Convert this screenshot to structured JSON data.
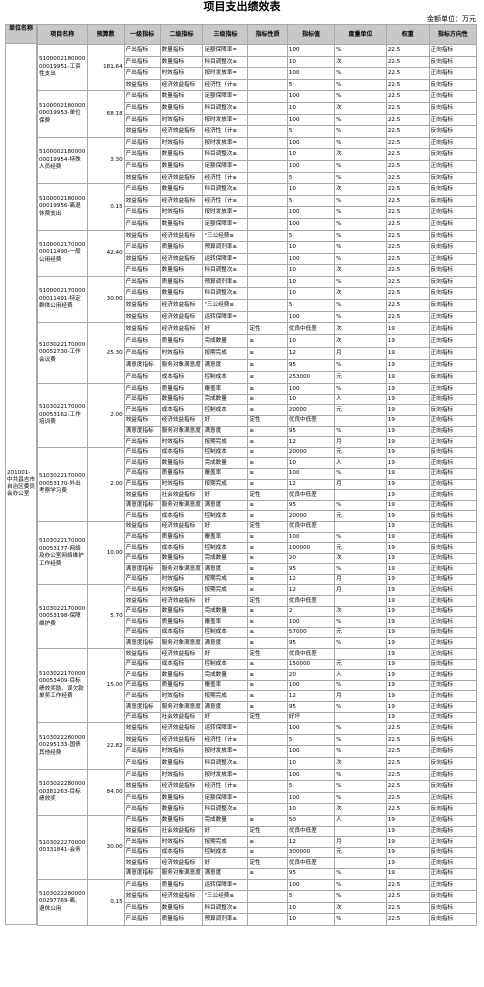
{
  "doc": {
    "title": "项目支出绩效表",
    "unit": "金额单位：万元"
  },
  "headers": [
    "单位名称",
    "项目名称",
    "预算数",
    "一级指标",
    "二级指标",
    "三级指标",
    "指标性质",
    "指标值",
    "度量单位",
    "权重",
    "指标方向性"
  ],
  "unit_name": "201001-中共昌吉市自治区委员会办公室",
  "projects": [
    {
      "name": "510000218000000019951-工资性支出",
      "amount": "181.64",
      "rows": [
        [
          "产出指标",
          "数量指标",
          "足额保障率=",
          "100",
          "%",
          "22.5",
          "正向指标"
        ],
        [
          "产出指标",
          "数量指标",
          "科目调整次≤",
          "10",
          "次",
          "22.5",
          "反向指标"
        ],
        [
          "产出指标",
          "时效指标",
          "按时发放率=",
          "100",
          "%",
          "22.5",
          "正向指标"
        ],
        [
          "效益指标",
          "经济效益指标",
          "经济性（计≤",
          "5",
          "%",
          "22.5",
          "反向指标"
        ]
      ]
    },
    {
      "name": "510000218000000019953-单位保费",
      "amount": "68.18",
      "rows": [
        [
          "产出指标",
          "数量指标",
          "足额保障率=",
          "100",
          "%",
          "22.5",
          "正向指标"
        ],
        [
          "产出指标",
          "数量指标",
          "科目调整次≤",
          "10",
          "次",
          "22.5",
          "反向指标"
        ],
        [
          "产出指标",
          "时效指标",
          "按时发放率=",
          "100",
          "%",
          "22.5",
          "正向指标"
        ],
        [
          "效益指标",
          "经济效益指标",
          "经济性（计≤",
          "5",
          "%",
          "22.5",
          "反向指标"
        ]
      ]
    },
    {
      "name": "510000218000000019954-特殊人员经费",
      "amount": "3.30",
      "rows": [
        [
          "产出指标",
          "时效指标",
          "按时发放率=",
          "100",
          "%",
          "22.5",
          "正向指标"
        ],
        [
          "产出指标",
          "数量指标",
          "科目调整次≤",
          "10",
          "次",
          "22.5",
          "反向指标"
        ],
        [
          "产出指标",
          "数量指标",
          "足额保障率=",
          "100",
          "%",
          "22.5",
          "正向指标"
        ],
        [
          "效益指标",
          "经济效益指标",
          "经济性（计≤",
          "5",
          "%",
          "22.5",
          "反向指标"
        ]
      ]
    },
    {
      "name": "510000218000000019956-离退休费支出",
      "amount": "0.15",
      "rows": [
        [
          "产出指标",
          "数量指标",
          "科目调整次≤",
          "10",
          "次",
          "22.5",
          "反向指标"
        ],
        [
          "效益指标",
          "经济效益指标",
          "经济性（计≤",
          "5",
          "%",
          "22.5",
          "反向指标"
        ],
        [
          "产出指标",
          "时效指标",
          "按时发放率=",
          "100",
          "%",
          "22.5",
          "正向指标"
        ],
        [
          "产出指标",
          "数量指标",
          "足额保障率=",
          "100",
          "%",
          "22.5",
          "正向指标"
        ]
      ]
    },
    {
      "name": "510000217000000011490-一般公用经费",
      "amount": "42.40",
      "rows": [
        [
          "效益指标",
          "经济效益指标",
          "\"三公经费≤",
          "5",
          "%",
          "22.5",
          "反向指标"
        ],
        [
          "产出指标",
          "质量指标",
          "预算调剂率≤",
          "10",
          "%",
          "22.5",
          "反向指标"
        ],
        [
          "效益指标",
          "经济效益指标",
          "运转保障率=",
          "100",
          "%",
          "22.5",
          "正向指标"
        ],
        [
          "产出指标",
          "数量指标",
          "科目调整次≤",
          "10",
          "次",
          "22.5",
          "反向指标"
        ]
      ]
    },
    {
      "name": "510000217000000011491-特定群体公用经费",
      "amount": "30.00",
      "rows": [
        [
          "产出指标",
          "质量指标",
          "预算调剂率≤",
          "10",
          "%",
          "22.5",
          "反向指标"
        ],
        [
          "产出指标",
          "数量指标",
          "科目调整次≤",
          "10",
          "次",
          "22.5",
          "反向指标"
        ],
        [
          "效益指标",
          "经济效益指标",
          "\"三公经费≤",
          "5",
          "%",
          "22.5",
          "反向指标"
        ],
        [
          "效益指标",
          "经济效益指标",
          "运转保障率=",
          "100",
          "%",
          "22.5",
          "正向指标"
        ]
      ]
    },
    {
      "name": "510302217000000052730-工作会议费",
      "amount": "25.30",
      "rows": [
        [
          "效益指标",
          "经济效益指标",
          "好",
          "定性",
          "优良中低差",
          "次",
          "19",
          "正向指标"
        ],
        [
          "产出指标",
          "质量指标",
          "完成数量",
          "≥",
          "10",
          "次",
          "19",
          "正向指标"
        ],
        [
          "产出指标",
          "时效指标",
          "按期完成",
          "≥",
          "12",
          "月",
          "19",
          "正向指标"
        ],
        [
          "满意度指标",
          "服务对象满意度",
          "满意度",
          "≥",
          "95",
          "%",
          "19",
          "正向指标"
        ],
        [
          "产出指标",
          "成本指标",
          "控制成本",
          "≤",
          "253000",
          "元",
          "19",
          "反向指标"
        ]
      ]
    },
    {
      "name": "510302217000000053162-工作培训费",
      "amount": "2.00",
      "rows": [
        [
          "产出指标",
          "质量指标",
          "覆盖率",
          "≥",
          "100",
          "%",
          "19",
          "正向指标"
        ],
        [
          "产出指标",
          "数量指标",
          "完成数量",
          "≥",
          "10",
          "人",
          "19",
          "正向指标"
        ],
        [
          "产出指标",
          "成本指标",
          "控制成本",
          "≤",
          "20000",
          "元",
          "19",
          "反向指标"
        ],
        [
          "效益指标",
          "经济效益指标",
          "好",
          "定性",
          "优良中低差",
          "",
          "19",
          "正向指标"
        ],
        [
          "满意度指标",
          "服务对象满意度",
          "满意度",
          "≥",
          "95",
          "%",
          "19",
          "正向指标"
        ],
        [
          "产出指标",
          "时效指标",
          "按期完成",
          "≤",
          "12",
          "月",
          "19",
          "正向指标"
        ]
      ]
    },
    {
      "name": "510302217000000053170-外出考察学习费",
      "amount": "2.00",
      "rows": [
        [
          "产出指标",
          "成本指标",
          "控制成本",
          "≤",
          "20000",
          "元",
          "19",
          "反向指标"
        ],
        [
          "产出指标",
          "数量指标",
          "完成数量",
          "≥",
          "10",
          "人",
          "19",
          "正向指标"
        ],
        [
          "产出指标",
          "质量指标",
          "覆盖率",
          "≥",
          "100",
          "%",
          "19",
          "正向指标"
        ],
        [
          "产出指标",
          "时效指标",
          "按期完成",
          "≤",
          "12",
          "月",
          "19",
          "正向指标"
        ],
        [
          "效益指标",
          "社会效益指标",
          "好",
          "定性",
          "优良中低差",
          "",
          "19",
          "正向指标"
        ],
        [
          "满意度指标",
          "服务对象满意度",
          "满意度",
          "≥",
          "95",
          "%",
          "19",
          "正向指标"
        ],
        [
          "产出指标",
          "成本指标",
          "控制成本",
          "≤",
          "20000",
          "元",
          "19",
          "反向指标"
        ]
      ]
    },
    {
      "name": "510302217000000053177-网络及办公室网络维护工作经费",
      "amount": "10.00",
      "rows": [
        [
          "效益指标",
          "经济效益指标",
          "好",
          "定性",
          "优良中低差",
          "",
          "19",
          "正向指标"
        ],
        [
          "产出指标",
          "质量指标",
          "覆盖率",
          "≥",
          "100",
          "%",
          "19",
          "正向指标"
        ],
        [
          "产出指标",
          "成本指标",
          "控制成本",
          "≤",
          "100000",
          "元",
          "19",
          "反向指标"
        ],
        [
          "产出指标",
          "数量指标",
          "完成数量",
          "≥",
          "20",
          "次",
          "19",
          "正向指标"
        ],
        [
          "满意度指标",
          "服务对象满意度",
          "满意度",
          "≥",
          "95",
          "%",
          "19",
          "正向指标"
        ],
        [
          "产出指标",
          "时效指标",
          "按期完成",
          "≤",
          "12",
          "月",
          "19",
          "正向指标"
        ]
      ]
    },
    {
      "name": "510302217000000053198-保障维护费",
      "amount": "5.70",
      "rows": [
        [
          "产出指标",
          "时效指标",
          "按期完成",
          "≤",
          "12",
          "月",
          "19",
          "正向指标"
        ],
        [
          "效益指标",
          "经济效益指标",
          "好",
          "定性",
          "优良中低差",
          "",
          "19",
          "正向指标"
        ],
        [
          "产出指标",
          "数量指标",
          "完成数量",
          "≥",
          "2",
          "次",
          "19",
          "正向指标"
        ],
        [
          "产出指标",
          "质量指标",
          "覆盖率",
          "≥",
          "100",
          "%",
          "19",
          "正向指标"
        ],
        [
          "产出指标",
          "成本指标",
          "控制成本",
          "≤",
          "57000",
          "元",
          "19",
          "反向指标"
        ],
        [
          "满意度指标",
          "服务对象满意度",
          "满意度",
          "≥",
          "95",
          "%",
          "19",
          "正向指标"
        ]
      ]
    },
    {
      "name": "510302217000000053409-目标绩效奖励、误欠款单奖工作经费",
      "amount": "15.00",
      "rows": [
        [
          "效益指标",
          "经济效益指标",
          "好",
          "定性",
          "优良中低差",
          "",
          "19",
          "正向指标"
        ],
        [
          "产出指标",
          "成本指标",
          "控制成本",
          "≤",
          "150000",
          "元",
          "19",
          "反向指标"
        ],
        [
          "产出指标",
          "数量指标",
          "完成数量",
          "≥",
          "20",
          "人",
          "19",
          "正向指标"
        ],
        [
          "产出指标",
          "质量指标",
          "覆盖率",
          "≥",
          "100",
          "%",
          "19",
          "正向指标"
        ],
        [
          "产出指标",
          "时效指标",
          "按期完成",
          "≤",
          "12",
          "月",
          "19",
          "正向指标"
        ],
        [
          "满意度指标",
          "服务对象满意度",
          "满意度",
          "≥",
          "95",
          "%",
          "19",
          "正向指标"
        ],
        [
          "产出指标",
          "社会效益指标",
          "好",
          "定性",
          "好坏",
          "",
          "19",
          "正向指标"
        ]
      ]
    },
    {
      "name": "510302228000000295133-国债其他经费",
      "amount": "22.82",
      "rows": [
        [
          "效益指标",
          "经济效益指标",
          "运转保障率=",
          "100",
          "%",
          "22.5",
          "正向指标"
        ],
        [
          "效益指标",
          "经济效益指标",
          "经济性（计≤",
          "5",
          "%",
          "22.5",
          "反向指标"
        ],
        [
          "产出指标",
          "时效指标",
          "按时发放率=",
          "100",
          "%",
          "22.5",
          "正向指标"
        ],
        [
          "产出指标",
          "数量指标",
          "科目调整次≤",
          "10",
          "次",
          "22.5",
          "反向指标"
        ]
      ]
    },
    {
      "name": "510302228000000381263-目标绩效奖",
      "amount": "84.00",
      "rows": [
        [
          "产出指标",
          "时效指标",
          "按时发放率=",
          "100",
          "%",
          "22.5",
          "正向指标"
        ],
        [
          "效益指标",
          "经济效益指标",
          "经济性（计≤",
          "5",
          "%",
          "22.5",
          "反向指标"
        ],
        [
          "产出指标",
          "数量指标",
          "足额保障率=",
          "100",
          "%",
          "22.5",
          "正向指标"
        ],
        [
          "产出指标",
          "数量指标",
          "科目调整次≤",
          "10",
          "次",
          "22.5",
          "反向指标"
        ]
      ]
    },
    {
      "name": "510302227000000331841-会务",
      "amount": "30.00",
      "rows": [
        [
          "产出指标",
          "数量指标",
          "完成数量",
          "≥",
          "50",
          "人",
          "19",
          "正向指标"
        ],
        [
          "效益指标",
          "社会效益指标",
          "好",
          "定性",
          "优良中低差",
          "",
          "19",
          "正向指标"
        ],
        [
          "产出指标",
          "时效指标",
          "按期完成",
          "≥",
          "12",
          "月",
          "19",
          "正向指标"
        ],
        [
          "产出指标",
          "成本指标",
          "控制成本",
          "≤",
          "300000",
          "元",
          "19",
          "反向指标"
        ],
        [
          "效益指标",
          "经济效益指标",
          "好",
          "定性",
          "优良中低差",
          "",
          "19",
          "正向指标"
        ],
        [
          "满意度指标",
          "服务对象满意度",
          "满意度",
          "≥",
          "95",
          "%",
          "19",
          "正向指标"
        ]
      ]
    },
    {
      "name": "510302228000000297769-离、退休公用",
      "amount": "0.15",
      "rows": [
        [
          "产出指标",
          "质量指标",
          "运转保障率=",
          "100",
          "%",
          "22.5",
          "正向指标"
        ],
        [
          "效益指标",
          "经济效益指标",
          "\"三公经费≤",
          "5",
          "%",
          "22.5",
          "反向指标"
        ],
        [
          "产出指标",
          "数量指标",
          "科目调整次≤",
          "10",
          "次",
          "22.5",
          "反向指标"
        ],
        [
          "产出指标",
          "质量指标",
          "预算调剂率≤",
          "10",
          "%",
          "22.5",
          "反向指标"
        ]
      ]
    }
  ]
}
